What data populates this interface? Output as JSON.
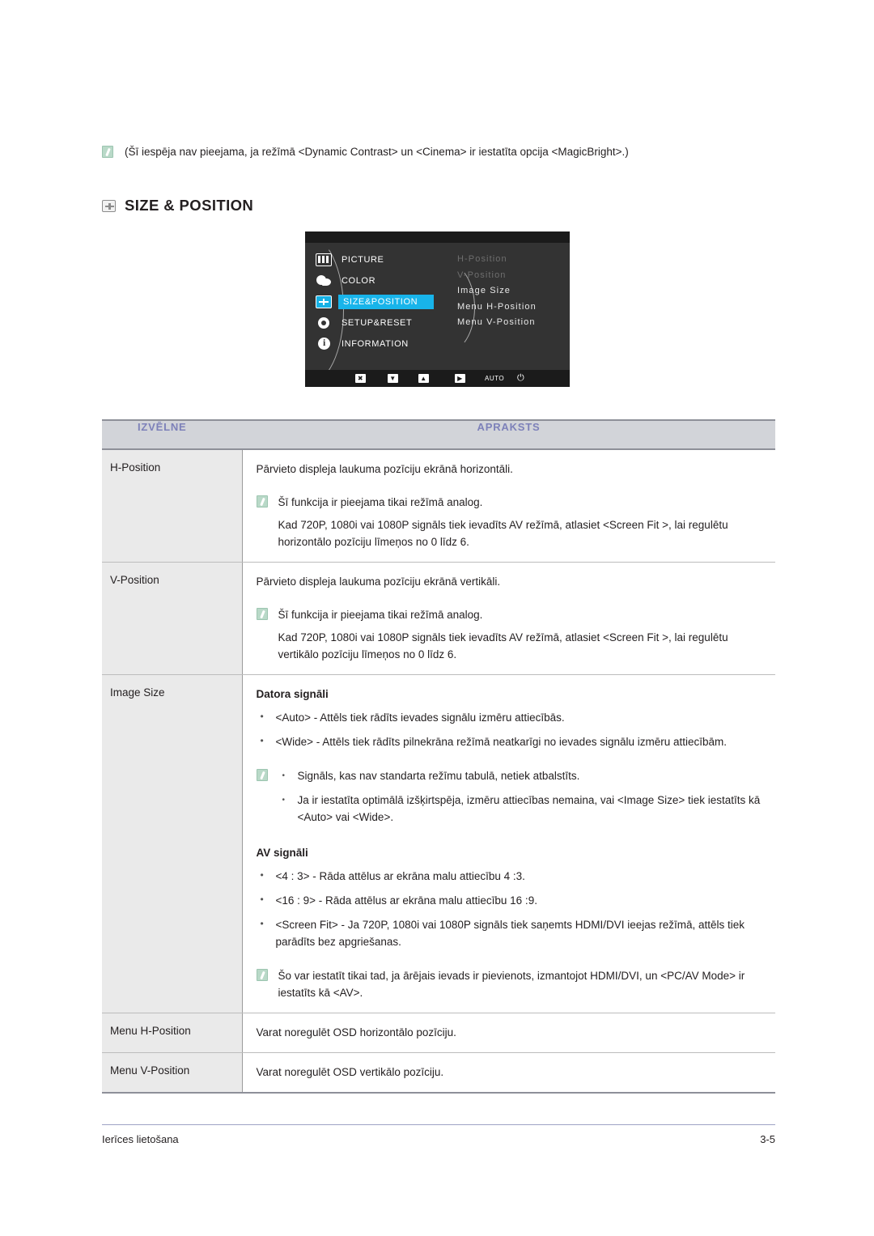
{
  "top_note": {
    "icon": "note-icon",
    "text": "(Šī iespēja nav pieejama, ja režīmā <Dynamic Contrast> un <Cinema> ir iestatīta opcija <MagicBright>.)"
  },
  "section": {
    "icon": "size-position-icon",
    "title": "SIZE & POSITION"
  },
  "osd": {
    "menu_items": [
      {
        "label": "PICTURE",
        "icon": "picture-icon",
        "selected": false
      },
      {
        "label": "COLOR",
        "icon": "color-icon",
        "selected": false
      },
      {
        "label": "SIZE&POSITION",
        "icon": "size-position-icon",
        "selected": true
      },
      {
        "label": "SETUP&RESET",
        "icon": "gear-icon",
        "selected": false
      },
      {
        "label": "INFORMATION",
        "icon": "info-icon",
        "selected": false
      }
    ],
    "sub_items": [
      {
        "label": "H-Position",
        "dimmed": true
      },
      {
        "label": "V-Position",
        "dimmed": true
      },
      {
        "label": "Image Size",
        "dimmed": false
      },
      {
        "label": "Menu H-Position",
        "dimmed": false
      },
      {
        "label": "Menu V-Position",
        "dimmed": false
      }
    ],
    "buttons": [
      {
        "name": "exit-button",
        "glyph": "✖"
      },
      {
        "name": "down-button",
        "glyph": "▼"
      },
      {
        "name": "up-button",
        "glyph": "▲"
      },
      {
        "name": "enter-button",
        "glyph": "▶"
      },
      {
        "name": "auto-button",
        "glyph": "AUTO"
      },
      {
        "name": "power-button",
        "glyph": "⏻"
      }
    ],
    "highlight_color": "#18b4ea"
  },
  "table": {
    "headers": {
      "menu": "IZVĒLNE",
      "description": "APRAKSTS"
    },
    "header_text_color": "#7d81b9",
    "header_bg_color": "#d2d4d9",
    "rows": [
      {
        "menu": "H-Position",
        "intro": "Pārvieto displeja laukuma pozīciju ekrānā horizontāli.",
        "note": "Šī funkcija ir pieejama tikai režīmā analog.",
        "note_extra": "Kad 720P, 1080i vai 1080P signāls tiek ievadīts AV režīmā, atlasiet <Screen Fit  >, lai regulētu horizontālo pozīciju līmeņos no 0 līdz 6."
      },
      {
        "menu": "V-Position",
        "intro": "Pārvieto displeja laukuma pozīciju ekrānā vertikāli.",
        "note": "Šī funkcija ir pieejama tikai režīmā analog.",
        "note_extra": "Kad 720P, 1080i vai 1080P signāls tiek ievadīts AV režīmā, atlasiet <Screen Fit  >, lai regulētu vertikālo pozīciju līmeņos no 0 līdz 6."
      },
      {
        "menu": "Image Size",
        "pc_heading": "Datora signāli",
        "pc_bullets": [
          "<Auto> - Attēls tiek rādīts ievades signālu izmēru attiecībās.",
          "<Wide> - Attēls tiek rādīts pilnekrāna režīmā neatkarīgi no ievades signālu izmēru attiecībām."
        ],
        "pc_note_bullets": [
          "Signāls, kas nav standarta režīmu tabulā, netiek atbalstīts.",
          "Ja ir iestatīta optimālā izšķirtspēja, izmēru attiecības nemaina, vai <Image Size> tiek iestatīts kā <Auto> vai <Wide>."
        ],
        "av_heading": "AV signāli",
        "av_bullets": [
          "<4 : 3> - Rāda attēlus ar ekrāna malu attiecību 4 :3.",
          "<16 : 9> - Rāda attēlus ar ekrāna malu attiecību 16 :9.",
          "<Screen Fit> - Ja 720P, 1080i vai 1080P signāls tiek saņemts HDMI/DVI ieejas režīmā, attēls tiek parādīts bez apgriešanas."
        ],
        "av_note": "Šo var iestatīt tikai tad, ja ārējais ievads ir pievienots, izmantojot HDMI/DVI, un <PC/AV Mode> ir iestatīts kā <AV>."
      },
      {
        "menu": "Menu H-Position",
        "intro": "Varat noregulēt OSD horizontālo pozīciju."
      },
      {
        "menu": "Menu V-Position",
        "intro": "Varat noregulēt OSD vertikālo pozīciju."
      }
    ]
  },
  "footer": {
    "left": "Ierīces lietošana",
    "right": "3-5"
  }
}
